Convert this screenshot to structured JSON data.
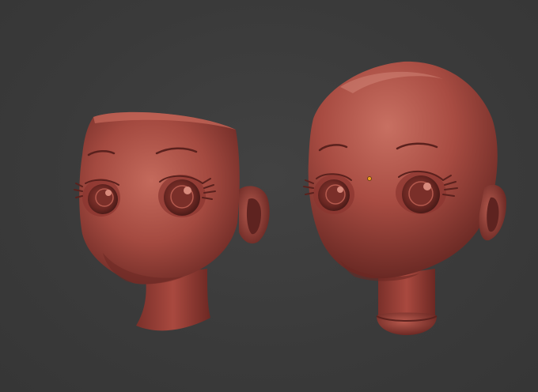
{
  "viewport": {
    "background": "#3b3b3b"
  },
  "material": {
    "skin_base": "#a0443c",
    "skin_light": "#c06558",
    "skin_highlight": "#d68273",
    "skin_shadow": "#6e2a25",
    "skin_deep": "#4e1c19"
  },
  "objects": [
    {
      "name": "head-open-top",
      "kind": "head mesh without cranium"
    },
    {
      "name": "head-bald",
      "kind": "head mesh with full cranium"
    }
  ],
  "origin_marker": {
    "color": "#f0a020"
  }
}
